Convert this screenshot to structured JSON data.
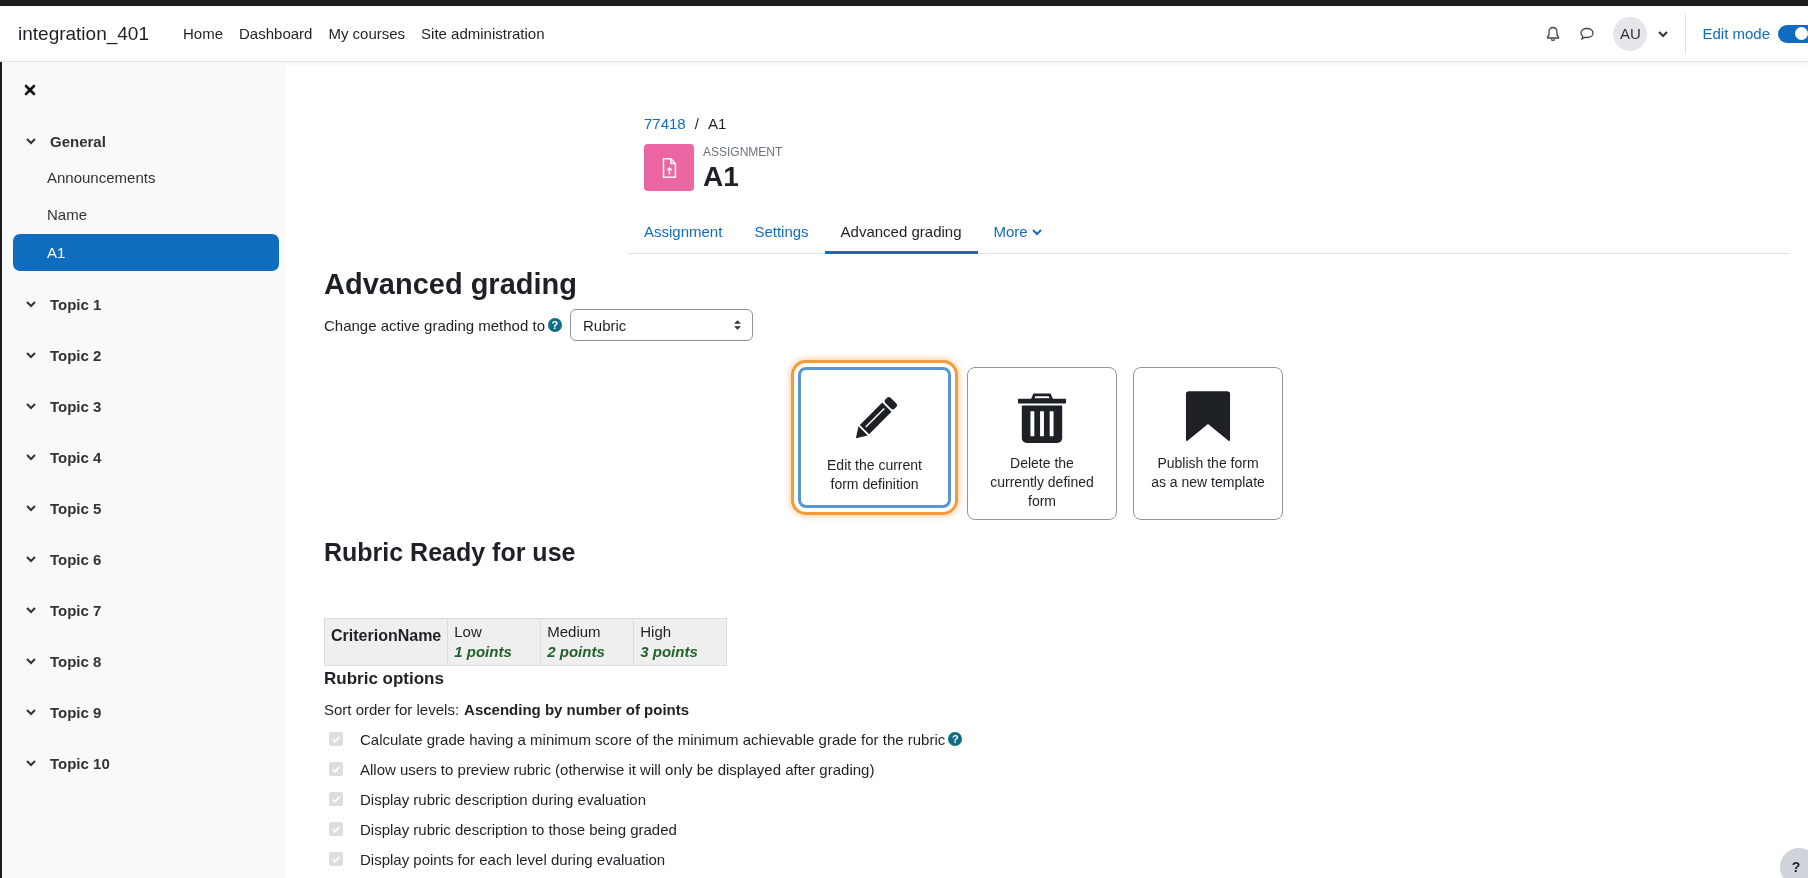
{
  "navbar": {
    "site_name": "integration_401",
    "links": [
      {
        "label": "Home"
      },
      {
        "label": "Dashboard"
      },
      {
        "label": "My courses"
      },
      {
        "label": "Site administration"
      }
    ],
    "avatar": "AU",
    "edit_mode": {
      "label": "Edit mode",
      "on": true
    }
  },
  "sidebar": {
    "items": [
      {
        "label": "General",
        "expanded": true,
        "children": [
          {
            "label": "Announcements",
            "selected": false
          },
          {
            "label": "Name",
            "selected": false
          },
          {
            "label": "A1",
            "selected": true
          }
        ]
      },
      {
        "label": "Topic 1",
        "expanded": true
      },
      {
        "label": "Topic 2",
        "expanded": true
      },
      {
        "label": "Topic 3",
        "expanded": true
      },
      {
        "label": "Topic 4",
        "expanded": true
      },
      {
        "label": "Topic 5",
        "expanded": true
      },
      {
        "label": "Topic 6",
        "expanded": true
      },
      {
        "label": "Topic 7",
        "expanded": true
      },
      {
        "label": "Topic 8",
        "expanded": true
      },
      {
        "label": "Topic 9",
        "expanded": true
      },
      {
        "label": "Topic 10",
        "expanded": true
      }
    ]
  },
  "breadcrumb": [
    {
      "label": "77418",
      "link": true
    },
    {
      "label": "A1",
      "link": false
    }
  ],
  "breadcrumb_separator": "/",
  "activity": {
    "type_label": "ASSIGNMENT",
    "title": "A1"
  },
  "tabs": [
    {
      "label": "Assignment",
      "selected": false
    },
    {
      "label": "Settings",
      "selected": false
    },
    {
      "label": "Advanced grading",
      "selected": true
    },
    {
      "label": "More",
      "selected": false,
      "dropdown": true
    }
  ],
  "page_title": "Advanced grading",
  "method": {
    "label": "Change active grading method to",
    "help_icon": "?",
    "value": "Rubric"
  },
  "actions": [
    {
      "kind": "edit",
      "label": "Edit the current form definition",
      "focused": true
    },
    {
      "kind": "delete",
      "label": "Delete the currently defined form",
      "focused": false
    },
    {
      "kind": "publish",
      "label": "Publish the form as a new template",
      "focused": false
    }
  ],
  "rubric": {
    "heading": "Rubric Ready for use",
    "criterion": "CriterionName",
    "levels": [
      {
        "definition": "Low",
        "score": "1 points"
      },
      {
        "definition": "Medium",
        "score": "2 points"
      },
      {
        "definition": "High",
        "score": "3 points"
      }
    ]
  },
  "options": {
    "heading": "Rubric options",
    "sort_label": "Sort order for levels:",
    "sort_value": "Ascending by number of points",
    "items": [
      {
        "label": "Calculate grade having a minimum score of the minimum achievable grade for the rubric",
        "checked": true,
        "disabled": true,
        "help_icon": "?"
      },
      {
        "label": "Allow users to preview rubric (otherwise it will only be displayed after grading)",
        "checked": true,
        "disabled": true
      },
      {
        "label": "Display rubric description during evaluation",
        "checked": true,
        "disabled": true
      },
      {
        "label": "Display rubric description to those being graded",
        "checked": true,
        "disabled": true
      },
      {
        "label": "Display points for each level during evaluation",
        "checked": true,
        "disabled": true
      }
    ]
  },
  "help_button": "?"
}
